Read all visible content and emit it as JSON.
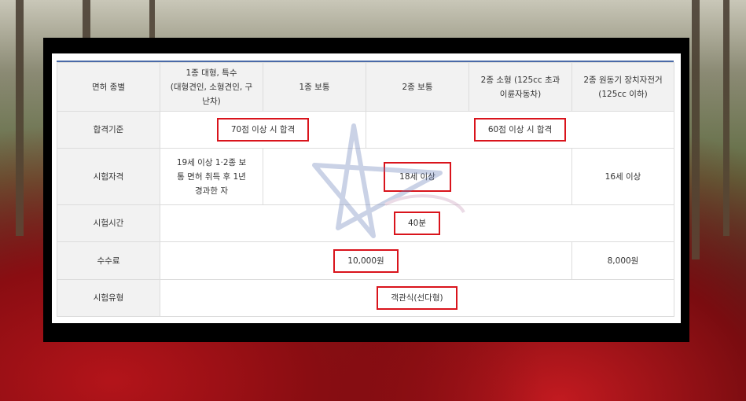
{
  "table": {
    "headers": [
      "면허 종별",
      "1종 대형, 특수 (대형견인, 소형견인, 구난차)",
      "1종 보통",
      "2종 보통",
      "2종 소형 (125cc 초과 이륜자동차)",
      "2종 원동기 장치자전거 (125cc 이하)"
    ],
    "header_lines": {
      "c1": [
        "1종 대형, 특수",
        "(대형견인, 소형견인, 구",
        "난차)"
      ],
      "c4": [
        "2종 소형 (125cc 초과",
        "이륜자동차)"
      ],
      "c5": [
        "2종 원동기 장치자전거",
        "(125cc 이하)"
      ]
    },
    "rows": {
      "pass": {
        "label": "합격기준",
        "a": "70점 이상 시 합격",
        "b": "60점 이상 시 합격"
      },
      "qual": {
        "label": "시험자격",
        "a_lines": [
          "19세 이상 1·2종 보",
          "통 면허 취득 후 1년",
          "경과한 자"
        ],
        "b": "18세 이상",
        "c": "16세 이상"
      },
      "time": {
        "label": "시험시간",
        "a": "40분"
      },
      "fee": {
        "label": "수수료",
        "a": "10,000원",
        "b": "8,000원"
      },
      "type": {
        "label": "시험유형",
        "a": "객관식(선다형)"
      }
    }
  },
  "colors": {
    "highlight": "#d9141c",
    "header_bg": "#f2f2f2",
    "top_rule": "#4a6aa8"
  }
}
